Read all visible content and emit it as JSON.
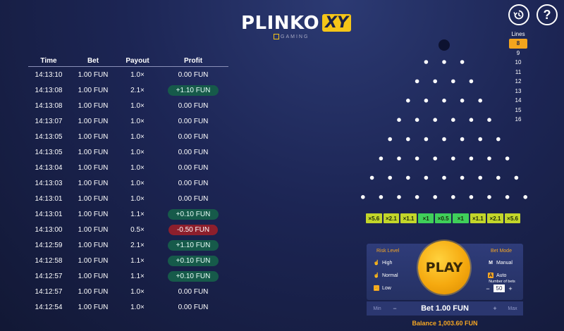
{
  "brand": {
    "name": "PLINKO",
    "suffix": "XY",
    "studio": "GAMING"
  },
  "top_buttons": {
    "history_icon": "history-icon",
    "help_label": "?"
  },
  "history": {
    "headers": {
      "time": "Time",
      "bet": "Bet",
      "payout": "Payout",
      "profit": "Profit"
    },
    "rows": [
      {
        "time": "14:13:10",
        "bet": "1.00 FUN",
        "payout": "1.0×",
        "profit": "0.00 FUN",
        "status": "neutral"
      },
      {
        "time": "14:13:08",
        "bet": "1.00 FUN",
        "payout": "2.1×",
        "profit": "+1.10 FUN",
        "status": "win"
      },
      {
        "time": "14:13:08",
        "bet": "1.00 FUN",
        "payout": "1.0×",
        "profit": "0.00 FUN",
        "status": "neutral"
      },
      {
        "time": "14:13:07",
        "bet": "1.00 FUN",
        "payout": "1.0×",
        "profit": "0.00 FUN",
        "status": "neutral"
      },
      {
        "time": "14:13:05",
        "bet": "1.00 FUN",
        "payout": "1.0×",
        "profit": "0.00 FUN",
        "status": "neutral"
      },
      {
        "time": "14:13:05",
        "bet": "1.00 FUN",
        "payout": "1.0×",
        "profit": "0.00 FUN",
        "status": "neutral"
      },
      {
        "time": "14:13:04",
        "bet": "1.00 FUN",
        "payout": "1.0×",
        "profit": "0.00 FUN",
        "status": "neutral"
      },
      {
        "time": "14:13:03",
        "bet": "1.00 FUN",
        "payout": "1.0×",
        "profit": "0.00 FUN",
        "status": "neutral"
      },
      {
        "time": "14:13:01",
        "bet": "1.00 FUN",
        "payout": "1.0×",
        "profit": "0.00 FUN",
        "status": "neutral"
      },
      {
        "time": "14:13:01",
        "bet": "1.00 FUN",
        "payout": "1.1×",
        "profit": "+0.10 FUN",
        "status": "win"
      },
      {
        "time": "14:13:00",
        "bet": "1.00 FUN",
        "payout": "0.5×",
        "profit": "-0.50 FUN",
        "status": "loss"
      },
      {
        "time": "14:12:59",
        "bet": "1.00 FUN",
        "payout": "2.1×",
        "profit": "+1.10 FUN",
        "status": "win"
      },
      {
        "time": "14:12:58",
        "bet": "1.00 FUN",
        "payout": "1.1×",
        "profit": "+0.10 FUN",
        "status": "win"
      },
      {
        "time": "14:12:57",
        "bet": "1.00 FUN",
        "payout": "1.1×",
        "profit": "+0.10 FUN",
        "status": "win"
      },
      {
        "time": "14:12:57",
        "bet": "1.00 FUN",
        "payout": "1.0×",
        "profit": "0.00 FUN",
        "status": "neutral"
      },
      {
        "time": "14:12:54",
        "bet": "1.00 FUN",
        "payout": "1.0×",
        "profit": "0.00 FUN",
        "status": "neutral"
      }
    ]
  },
  "board": {
    "rows": 8
  },
  "lines": {
    "title": "Lines",
    "options": [
      "8",
      "9",
      "10",
      "11",
      "12",
      "13",
      "14",
      "15",
      "16"
    ],
    "selected": "8"
  },
  "multipliers": [
    "×5.6",
    "×2.1",
    "×1.1",
    "×1",
    "×0.5",
    "×1",
    "×1.1",
    "×2.1",
    "×5.6"
  ],
  "risk": {
    "title": "Risk Level",
    "options": [
      {
        "label": "High",
        "icon": "hand-icon",
        "selected": false
      },
      {
        "label": "Normal",
        "icon": "hand-icon",
        "selected": false
      },
      {
        "label": "Low",
        "icon": "hand-icon",
        "selected": true
      }
    ]
  },
  "play": {
    "label": "PLAY"
  },
  "bet_mode": {
    "title": "Bet Mode",
    "options": [
      {
        "label": "Manual",
        "icon": "M",
        "selected": false
      },
      {
        "label": "Auto",
        "icon": "A",
        "selected": true
      }
    ],
    "number_of_bets_label": "Number of bets",
    "number_of_bets": "50",
    "minus": "−",
    "plus": "+"
  },
  "bet": {
    "min_label": "Min",
    "max_label": "Max",
    "minus": "−",
    "plus": "+",
    "amount": "Bet 1.00 FUN"
  },
  "balance": "Balance 1,003.60 FUN",
  "colors": {
    "accent": "#f5a623",
    "win": "#165a4a",
    "loss": "#8d1f2c",
    "multiplier": "#c3d62a",
    "multiplier_mid": "#3fcf5a"
  }
}
